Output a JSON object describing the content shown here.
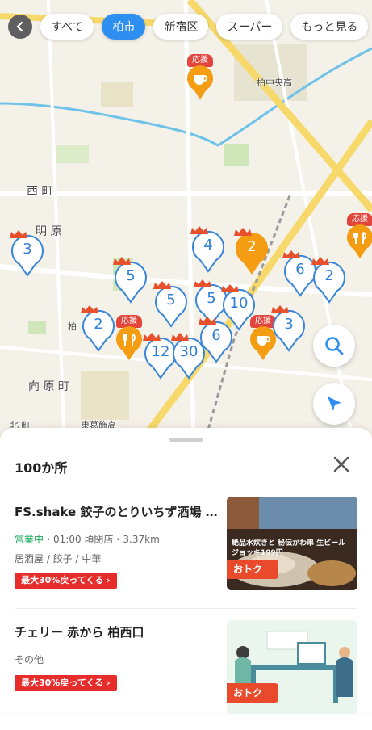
{
  "chips": {
    "all": "すべて",
    "kashiwa": "柏市",
    "shinjuku": "新宿区",
    "super": "スーパー",
    "more": "もっと見る"
  },
  "map": {
    "labels": {
      "nishimachi": "西 町",
      "akehara": "明 原",
      "kashiwanaka": "柏中央高",
      "muko": "向 原 町",
      "kashiwa_short": "柏",
      "kita_machi": "北 町",
      "higashi": "東葛飾高"
    },
    "support_tag": "応援",
    "pins": [
      "3",
      "4",
      "2",
      "5",
      "6",
      "2",
      "5",
      "5",
      "10",
      "2",
      "3",
      "12",
      "30",
      "6"
    ]
  },
  "sheet": {
    "count": "100か所"
  },
  "cards": [
    {
      "title": "FS.shake 餃子のとりいちず酒場 柏…",
      "status": "営業中",
      "hours": "・01:00 頃閉店・3.37km",
      "genre": "居酒屋 / 餃子 / 中華",
      "cashback": "最大30%戻ってくる ›",
      "badge": "おトク",
      "thumb_text": "絶品水炊きと 秘伝かわ串 生ビールジョッキ199円"
    },
    {
      "title": "チェリー 赤から 柏西口",
      "genre": "その他",
      "cashback": "最大30%戻ってくる ›",
      "badge": "おトク"
    }
  ],
  "colors": {
    "accent": "#2f8ff0",
    "pin_border": "#3a86d8",
    "orange": "#f49c12",
    "red": "#e72c2c",
    "open_green": "#1aaa55"
  }
}
